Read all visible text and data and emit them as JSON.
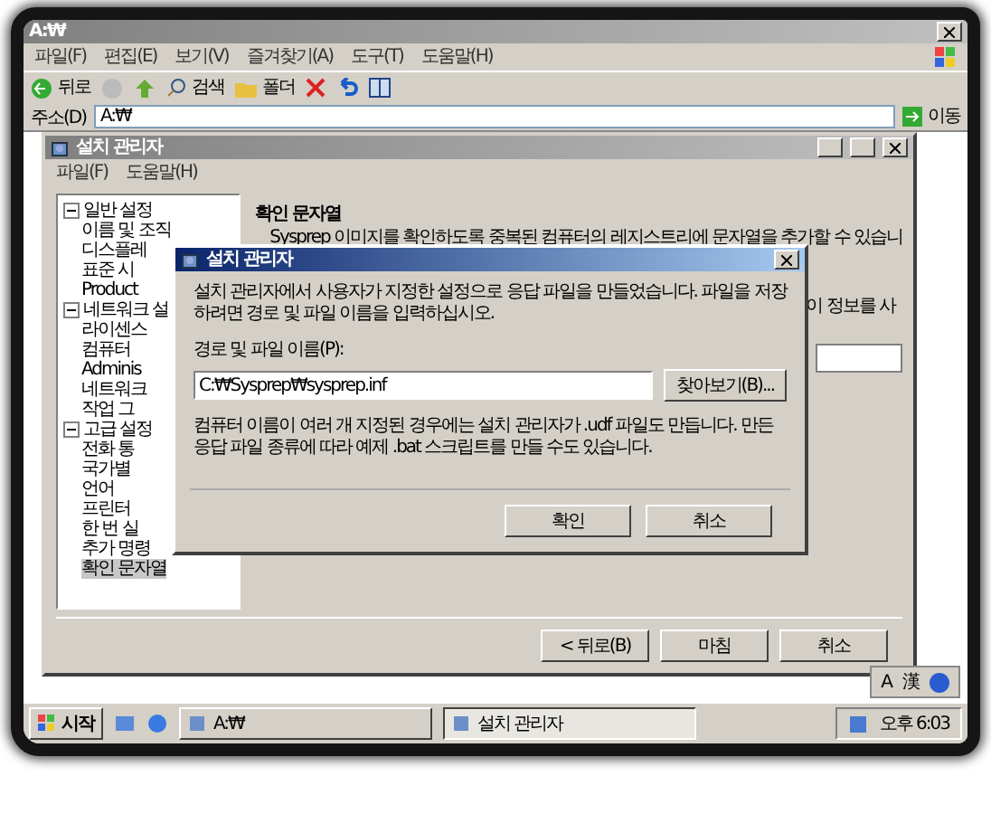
{
  "explorer": {
    "title": "A:₩",
    "menu": [
      "파일(F)",
      "편집(E)",
      "보기(V)",
      "즐겨찾기(A)",
      "도구(T)",
      "도움말(H)"
    ],
    "toolbar": {
      "back": "뒤로",
      "search": "검색",
      "folders": "폴더"
    },
    "address": {
      "label": "주소(D)",
      "value": "A:₩",
      "go": "이동"
    }
  },
  "setup_manager": {
    "title": "설치 관리자",
    "menu": [
      "파일(F)",
      "도움말(H)"
    ],
    "tree": [
      {
        "label": "일반 설정",
        "expanded": true,
        "selected": false,
        "children": [
          {
            "label": "이름 및 조직",
            "selected": false
          },
          {
            "label": "디스플레",
            "selected": false
          },
          {
            "label": "표준 시",
            "selected": false
          },
          {
            "label": "Product",
            "selected": false
          }
        ]
      },
      {
        "label": "네트워크 설",
        "expanded": true,
        "selected": false,
        "children": [
          {
            "label": "라이센스",
            "selected": false
          },
          {
            "label": "컴퓨터",
            "selected": false
          },
          {
            "label": "Adminis",
            "selected": false
          },
          {
            "label": "네트워크",
            "selected": false
          },
          {
            "label": "작업 그",
            "selected": false
          }
        ]
      },
      {
        "label": "고급 설정",
        "expanded": true,
        "selected": false,
        "children": [
          {
            "label": "전화 통",
            "selected": false
          },
          {
            "label": "국가별",
            "selected": false
          },
          {
            "label": "언어",
            "selected": false
          },
          {
            "label": "프린터",
            "selected": false
          },
          {
            "label": "한 번 실",
            "selected": false
          },
          {
            "label": "추가 명령",
            "selected": false
          },
          {
            "label": "확인 문자열",
            "selected": true
          }
        ]
      }
    ],
    "page": {
      "heading": "확인 문자열",
      "text": "Sysprep 이미지를 확인하도록 중복된 컴퓨터의 레지스트리에 문자열을 추가할 수 있습니",
      "text_2": "이 정보를 사"
    },
    "buttons": [
      "< 뒤로(B)",
      "마침",
      "취소"
    ]
  },
  "dialog": {
    "title": "설치 관리자",
    "message": "설치 관리자에서 사용자가 지정한 설정으로 응답 파일을 만들었습니다. 파일을 저장하려면 경로 및 파일 이름을 입력하십시오.",
    "field_label": "경로 및 파일 이름(P):",
    "path": "C:₩Sysprep₩sysprep.inf",
    "browse": "찾아보기(B)...",
    "note": "컴퓨터 이름이 여러 개 지정된 경우에는 설치 관리자가 .udf 파일도 만듭니다. 만든 응답 파일 종류에 따라 예제 .bat 스크립트를 만들 수도 있습니다.",
    "buttons": [
      "확인",
      "취소"
    ]
  },
  "taskbar": {
    "start": "시작",
    "tasks": [
      {
        "label": "A:₩",
        "selected": false
      },
      {
        "label": "설치 관리자",
        "selected": true
      }
    ],
    "language": [
      "A",
      "漢"
    ],
    "clock": "오후 6:03"
  }
}
